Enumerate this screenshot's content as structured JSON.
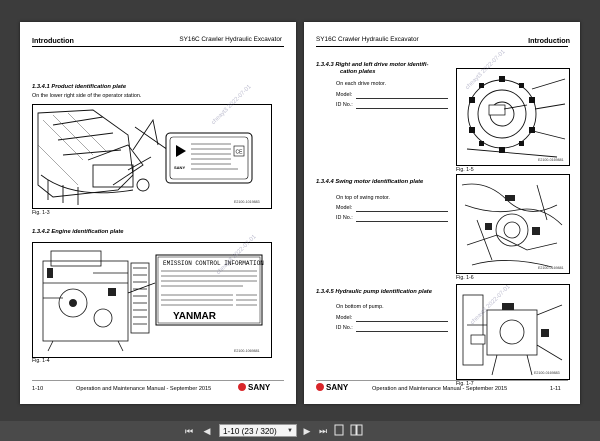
{
  "left_page": {
    "header_title": "Introduction",
    "header_model": "SY16C Crawler Hydraulic Excavator",
    "section1_heading": "1.3.4.1  Product identification plate",
    "section1_text": "On the lower right side of the operator station.",
    "fig1_code": "E2100-1019883",
    "fig1_caption": "Fig.  1-3",
    "section2_heading": "1.3.4.2  Engine identification plate",
    "fig2_code": "E2100-1069881",
    "fig2_caption": "Fig.  1-4",
    "fig2_plate_title": "EMISSION CONTROL INFORMATION",
    "fig2_plate_brand": "YANMAR",
    "footer_page": "1-10",
    "footer_manual": "Operation and Maintenance Manual - September 2015",
    "footer_logo": "SANY",
    "watermark": "cheayt3  2022-07-01"
  },
  "right_page": {
    "header_model": "SY16C Crawler Hydraulic Excavator",
    "header_title": "Introduction",
    "section3_heading_1": "1.3.4.3  Right and left drive motor identifi-",
    "section3_heading_2": "cation plates",
    "section3_text": "On each drive motor.",
    "section3_model_label": "Model:",
    "section3_id_label": "ID No.:",
    "fig3_code": "E2100-0169881",
    "fig3_caption": "Fig.  1-5",
    "section4_heading": "1.3.4.4  Swing motor identification plate",
    "section4_text": "On top of swing motor.",
    "section4_model_label": "Model:",
    "section4_id_label": "ID No.:",
    "fig4_code": "E2100-0169881",
    "fig4_caption": "Fig.  1-6",
    "section5_heading": "1.3.4.5  Hydraulic pump identification plate",
    "section5_text": "On bottom of pump.",
    "section5_model_label": "Model:",
    "section5_id_label": "ID No.:",
    "fig5_code": "E2100-0169883",
    "fig5_caption": "Fig.  1-7",
    "footer_logo": "SANY",
    "footer_manual": "Operation and Maintenance Manual - September 2015",
    "footer_page": "1-11",
    "watermark": "cheayt3  2022-07-01"
  },
  "toolbar": {
    "page_indicator": "1-10 (23 / 320)",
    "icons": [
      "first-page-icon",
      "prev-page-icon",
      "page-select-dropdown",
      "next-page-icon",
      "last-page-icon",
      "single-page-view-icon",
      "two-page-view-icon"
    ]
  },
  "colors": {
    "viewer_bg": "#3c3c3c",
    "toolbar_bg": "#4a4a4a",
    "sany_red": "#d9262a"
  }
}
